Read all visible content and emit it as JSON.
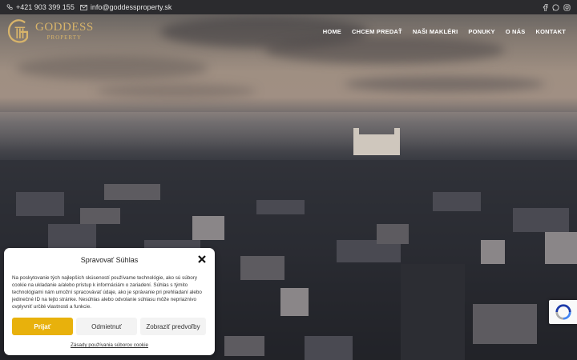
{
  "topbar": {
    "phone": "+421 903 399 155",
    "email": "info@goddessproperty.sk",
    "phone_icon": "phone-icon",
    "email_icon": "mail-icon",
    "social": [
      "facebook-icon",
      "whatsapp-icon",
      "instagram-icon"
    ]
  },
  "logo": {
    "name": "GODDESS",
    "sub": "PROPERTY"
  },
  "nav": {
    "items": [
      "HOME",
      "CHCEM PREDAŤ",
      "NAŠI MAKLÉRI",
      "PONUKY",
      "O NÁS",
      "KONTAKT"
    ]
  },
  "cookie": {
    "title": "Spravovať Súhlas",
    "text": "Na poskytovanie tých najlepších skúseností používame technológie, ako sú súbory cookie na ukladanie a/alebo prístup k informáciám o zariadení. Súhlas s týmito technológiami nám umožní spracovávať údaje, ako je správanie pri prehliadaní alebo jedinečné ID na tejto stránke. Nesúhlas alebo odvolanie súhlasu môže nepriaznivo ovplyvniť určité vlastnosti a funkcie.",
    "accept": "Prijať",
    "deny": "Odmietnuť",
    "prefs": "Zobraziť predvoľby",
    "policy_link": "Zásady používania súborov cookie"
  },
  "colors": {
    "accent": "#e8b10c",
    "logo_gold": "#d8b46a",
    "topbar": "#2b2b2e"
  }
}
